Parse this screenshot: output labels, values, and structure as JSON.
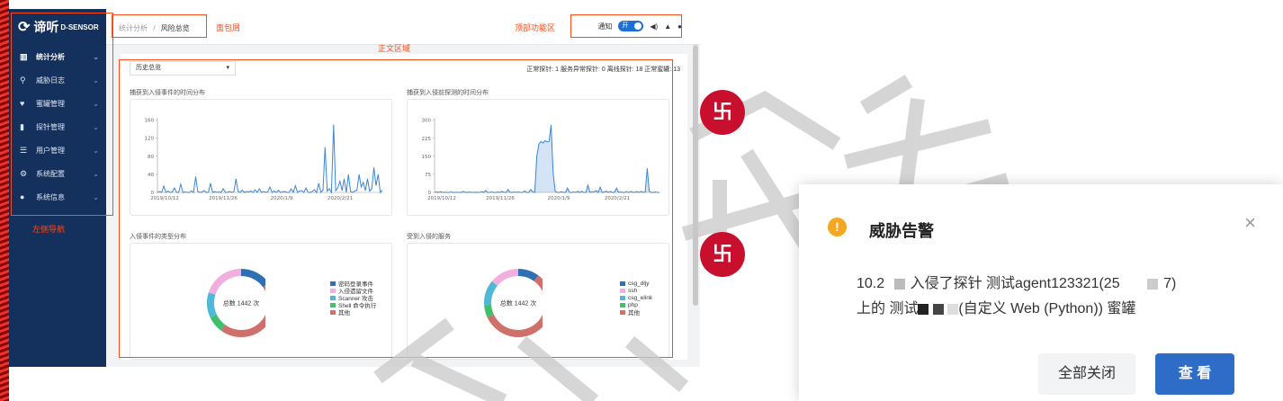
{
  "app": {
    "logo_text": "谛听",
    "logo_sub": "D-SENSOR"
  },
  "sidebar": {
    "items": [
      {
        "label": "统计分析",
        "icon": "bar-chart-icon",
        "glyph": "▥",
        "active": true
      },
      {
        "label": "威胁日志",
        "icon": "search-icon",
        "glyph": "⚲"
      },
      {
        "label": "蜜罐管理",
        "icon": "heartbeat-icon",
        "glyph": "♥"
      },
      {
        "label": "探针管理",
        "icon": "probe-icon",
        "glyph": "▮"
      },
      {
        "label": "用户管理",
        "icon": "users-sliders-icon",
        "glyph": "☰"
      },
      {
        "label": "系统配置",
        "icon": "gears-icon",
        "glyph": "⚙"
      },
      {
        "label": "系统信息",
        "icon": "info-icon",
        "glyph": "●"
      }
    ]
  },
  "breadcrumb": {
    "parent": "统计分析",
    "sep": "/",
    "current": "风险总览"
  },
  "header_tools": {
    "notify_label": "通知",
    "toggle_label": "开",
    "sound": "🔊",
    "bell": "🔔",
    "user": "👤"
  },
  "annotations": {
    "breadcrumb": "面包屑",
    "toolbar": "顶部功能区",
    "content": "正文区域",
    "sidebar": "左侧导航"
  },
  "filter": {
    "selected": "历史总览",
    "arrow": "▾"
  },
  "stats_text": "正常探针: 1   服务异常探针: 0   离线探针: 18   正常蜜罐: 13",
  "panels": {
    "intrusion_time": "捕获到入侵事件的时间分布",
    "probe_time": "捕获到入侵前探测的时间分布",
    "event_types": "入侵事件的类型分布",
    "services": "受到入侵的服务"
  },
  "chart_data": [
    {
      "type": "line",
      "title": "捕获到入侵事件的时间分布",
      "x_ticks": [
        "2019/10/12",
        "2019/11/26",
        "2020/1/9",
        "2020/2/21"
      ],
      "y_ticks": [
        0,
        40,
        80,
        120,
        160
      ],
      "ylim": [
        0,
        165
      ],
      "values": [
        0,
        2,
        0,
        14,
        0,
        3,
        0,
        1,
        10,
        0,
        0,
        18,
        0,
        1,
        0,
        0,
        3,
        0,
        35,
        2,
        0,
        1,
        4,
        0,
        0,
        20,
        0,
        2,
        0,
        1,
        0,
        8,
        0,
        0,
        2,
        0,
        1,
        30,
        2,
        0,
        5,
        0,
        2,
        1,
        3,
        0,
        6,
        0,
        8,
        0,
        2,
        0,
        1,
        12,
        0,
        3,
        0,
        5,
        0,
        1,
        2,
        0,
        0,
        8,
        0,
        15,
        0,
        3,
        4,
        0,
        10,
        0,
        0,
        2,
        6,
        0,
        20,
        0,
        5,
        100,
        3,
        8,
        0,
        150,
        4,
        10,
        25,
        4,
        30,
        0,
        40,
        2,
        0,
        3,
        5,
        40,
        12,
        22,
        4,
        30,
        3,
        8,
        55,
        15,
        40,
        0,
        5
      ]
    },
    {
      "type": "area",
      "title": "捕获到入侵前探测的时间分布",
      "x_ticks": [
        "2019/10/12",
        "2019/11/26",
        "2020/1/9",
        "2020/2/21"
      ],
      "y_ticks": [
        0,
        75,
        150,
        225,
        300
      ],
      "ylim": [
        0,
        310
      ],
      "values": [
        0,
        2,
        0,
        3,
        0,
        1,
        0,
        0,
        2,
        0,
        0,
        1,
        0,
        0,
        4,
        0,
        0,
        2,
        0,
        0,
        1,
        0,
        0,
        3,
        0,
        8,
        0,
        0,
        2,
        0,
        0,
        2,
        0,
        4,
        0,
        0,
        12,
        0,
        0,
        2,
        0,
        2,
        0,
        0,
        6,
        0,
        0,
        12,
        3,
        0,
        150,
        200,
        212,
        205,
        215,
        210,
        212,
        280,
        80,
        5,
        0,
        0,
        3,
        0,
        0,
        18,
        0,
        0,
        2,
        0,
        4,
        0,
        5,
        0,
        0,
        30,
        0,
        3,
        2,
        8,
        0,
        22,
        0,
        2,
        5,
        0,
        4,
        0,
        0,
        18,
        0,
        2,
        0,
        0,
        3,
        0,
        4,
        0,
        1,
        3,
        0,
        4,
        0,
        2,
        100,
        5,
        0,
        0,
        2,
        0,
        0
      ]
    },
    {
      "type": "pie",
      "title": "入侵事件的类型分布",
      "center_label": "总数 1442 次",
      "series": [
        {
          "name": "密码登录事件",
          "value": 0.15,
          "color": "#2f6fb3"
        },
        {
          "name": "其他",
          "value": 0.45,
          "color": "#d0706b"
        },
        {
          "name": "Shell 命令执行",
          "value": 0.08,
          "color": "#3fc06a"
        },
        {
          "name": "Scanner 攻击",
          "value": 0.12,
          "color": "#4fb8d6"
        },
        {
          "name": "入侵遗留文件",
          "value": 0.2,
          "color": "#f1aede"
        }
      ],
      "legend_order": [
        "密码登录事件",
        "入侵遗留文件",
        "Scanner 攻击",
        "Shell 命令执行",
        "其他"
      ]
    },
    {
      "type": "pie",
      "title": "受到入侵的服务",
      "center_label": "总数 1442 次",
      "series": [
        {
          "name": "csg_dljy",
          "value": 0.1,
          "color": "#2f6fb3"
        },
        {
          "name": "其他",
          "value": 0.58,
          "color": "#d0706b"
        },
        {
          "name": "php",
          "value": 0.06,
          "color": "#3fc06a"
        },
        {
          "name": "csg_elink",
          "value": 0.12,
          "color": "#4fb8d6"
        },
        {
          "name": "ssh",
          "value": 0.14,
          "color": "#f1aede"
        }
      ],
      "legend_order": [
        "csg_dljy",
        "ssh",
        "csg_elink",
        "php",
        "其他"
      ]
    }
  ],
  "colors": {
    "sidebar": "#14305c",
    "accent": "#1d6fd8",
    "line": "#3a86d6",
    "annotation": "#ff4b1a"
  },
  "notification": {
    "icon": "!",
    "title": "威胁告警",
    "close": "×",
    "line1_prefix": "10.2",
    "line1_mid": "入侵了探针 测试agent123321(25",
    "line1_end": "7)",
    "line2_prefix": "上的 测试",
    "line2_end": "(自定义 Web (Python)) 蜜罐",
    "close_all": "全部关闭",
    "view": "查 看"
  },
  "sticker_glyph": "卐"
}
